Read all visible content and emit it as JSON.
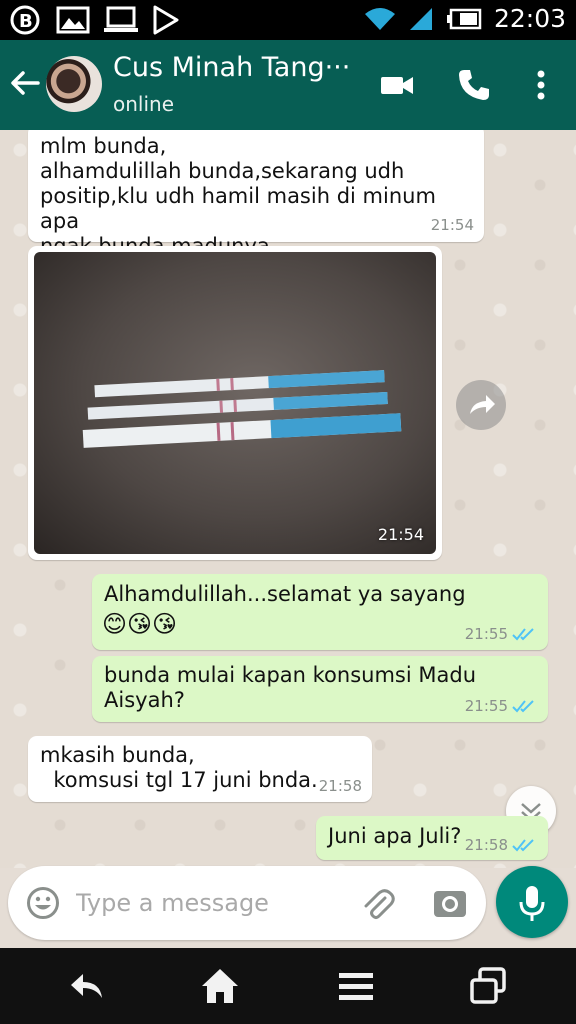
{
  "status_bar": {
    "time": "22:03",
    "left_icons": [
      "bbm-icon",
      "gallery-icon",
      "laptop-icon",
      "play-store-icon"
    ],
    "right_icons": [
      "wifi-icon",
      "signal-icon",
      "battery-icon"
    ]
  },
  "header": {
    "contact_name": "Cus Minah Tang···",
    "contact_status": "online",
    "icons": [
      "back-arrow-icon",
      "video-call-icon",
      "phone-icon",
      "more-vert-icon"
    ]
  },
  "messages": [
    {
      "direction": "in",
      "text": "mlm bunda,\nalhamdulillah bunda,sekarang udh\npositip,klu udh hamil masih di minum apa\nngak bunda madunya",
      "time": "21:54"
    },
    {
      "direction": "in",
      "type": "image",
      "description_icon": "photo",
      "time": "21:54"
    },
    {
      "direction": "out",
      "text": "Alhamdulillah...selamat ya sayang",
      "emoji": "😊😘😘",
      "time": "21:55",
      "status": "read"
    },
    {
      "direction": "out",
      "text": "bunda mulai kapan konsumsi Madu\nAisyah?",
      "time": "21:55",
      "status": "read"
    },
    {
      "direction": "in",
      "text": "mkasih bunda,\n  komsusi tgl 17 juni bnda.",
      "time": "21:58"
    },
    {
      "direction": "out",
      "text": "Juni apa Juli?",
      "time": "21:58",
      "status": "read"
    }
  ],
  "composer": {
    "placeholder": "Type a message",
    "value": ""
  },
  "colors": {
    "header": "#075e54",
    "outgoing_bubble": "#dcf8c6",
    "incoming_bubble": "#ffffff",
    "mic_button": "#00897b",
    "read_ticks": "#4fc3f7"
  }
}
